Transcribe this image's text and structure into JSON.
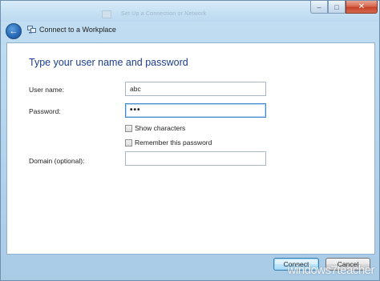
{
  "window": {
    "title": "Connect to a Workplace",
    "background_title": "Set Up a Connection or Network",
    "caption": {
      "minimize": "–",
      "maximize": "□",
      "close": "✕"
    }
  },
  "nav": {
    "back_icon": "back-arrow-icon",
    "title_icon": "workplace-network-icon"
  },
  "form": {
    "heading": "Type your user name and password",
    "username_label": "User name:",
    "username_value": "abc",
    "password_label": "Password:",
    "password_value": "•••",
    "show_characters_label": "Show characters",
    "show_characters_checked": false,
    "remember_label": "Remember this password",
    "remember_checked": false,
    "domain_label": "Domain (optional):",
    "domain_value": ""
  },
  "footer": {
    "connect_label": "Connect",
    "cancel_label": "Cancel",
    "watermark": "windows7teacher"
  },
  "colors": {
    "heading": "#1c3d8c",
    "frame": "#b7d6ee",
    "close_button": "#c7432a",
    "focus_border": "#3d8ad3"
  }
}
